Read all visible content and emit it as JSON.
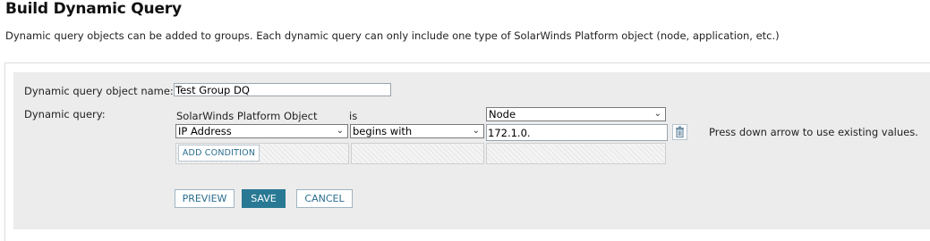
{
  "page": {
    "title": "Build Dynamic Query",
    "description": "Dynamic query objects can be added to groups. Each dynamic query can only include one type of SolarWinds Platform object (node, application, etc.)"
  },
  "form": {
    "name_label": "Dynamic query object name:",
    "name_value": "Test Group DQ",
    "query_label": "Dynamic query:",
    "object_header": "SolarWinds Platform Object",
    "operator_header": "is",
    "object_type_value": "Node",
    "condition": {
      "field_value": "IP Address",
      "operator_value": "begins with",
      "value": "172.1.0."
    },
    "hint": "Press down arrow to use existing values.",
    "add_condition_label": "ADD CONDITION"
  },
  "actions": {
    "preview": "PREVIEW",
    "save": "SAVE",
    "cancel": "CANCEL"
  },
  "icons": {
    "chevron": "chevron-down-icon",
    "delete": "trash-icon"
  },
  "colors": {
    "primary_button": "#297994",
    "link_text": "#2b6d8f",
    "panel_bg": "#ececec"
  }
}
